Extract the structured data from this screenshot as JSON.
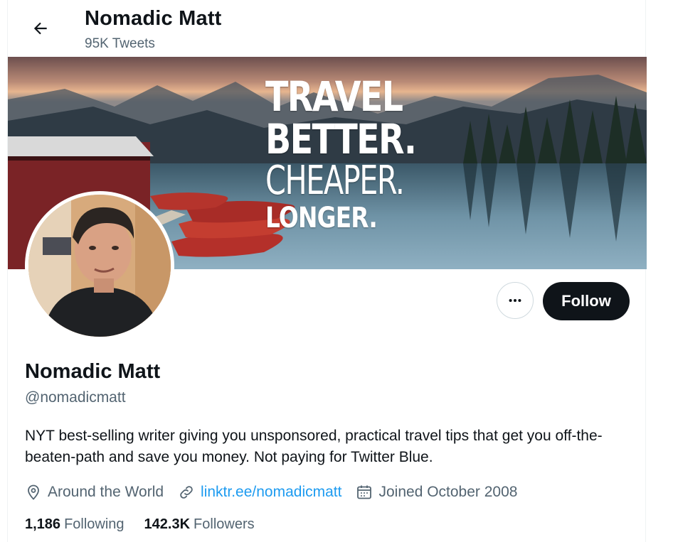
{
  "header": {
    "title": "Nomadic Matt",
    "tweet_count": "95K Tweets"
  },
  "banner": {
    "line1": "TRAVEL",
    "line2": "BETTER.",
    "line3": "CHEAPER.",
    "line4": "LONGER."
  },
  "actions": {
    "follow_label": "Follow"
  },
  "profile": {
    "name": "Nomadic Matt",
    "handle": "@nomadicmatt",
    "bio": "NYT best-selling writer giving you unsponsored, practical travel tips that get you off-the-beaten-path and save you money. Not paying for Twitter Blue.",
    "location": "Around the World",
    "website": "linktr.ee/nomadicmatt",
    "joined": "Joined October 2008"
  },
  "stats": {
    "following_count": "1,186",
    "following_label": "Following",
    "followers_count": "142.3K",
    "followers_label": "Followers"
  },
  "icons": {
    "back": "arrow-left-icon",
    "more": "more-horizontal-icon",
    "location": "location-pin-icon",
    "link": "link-icon",
    "calendar": "calendar-icon"
  },
  "colors": {
    "text_primary": "#0f1419",
    "text_secondary": "#536471",
    "link": "#1d9bf0",
    "follow_bg": "#0f1419"
  }
}
